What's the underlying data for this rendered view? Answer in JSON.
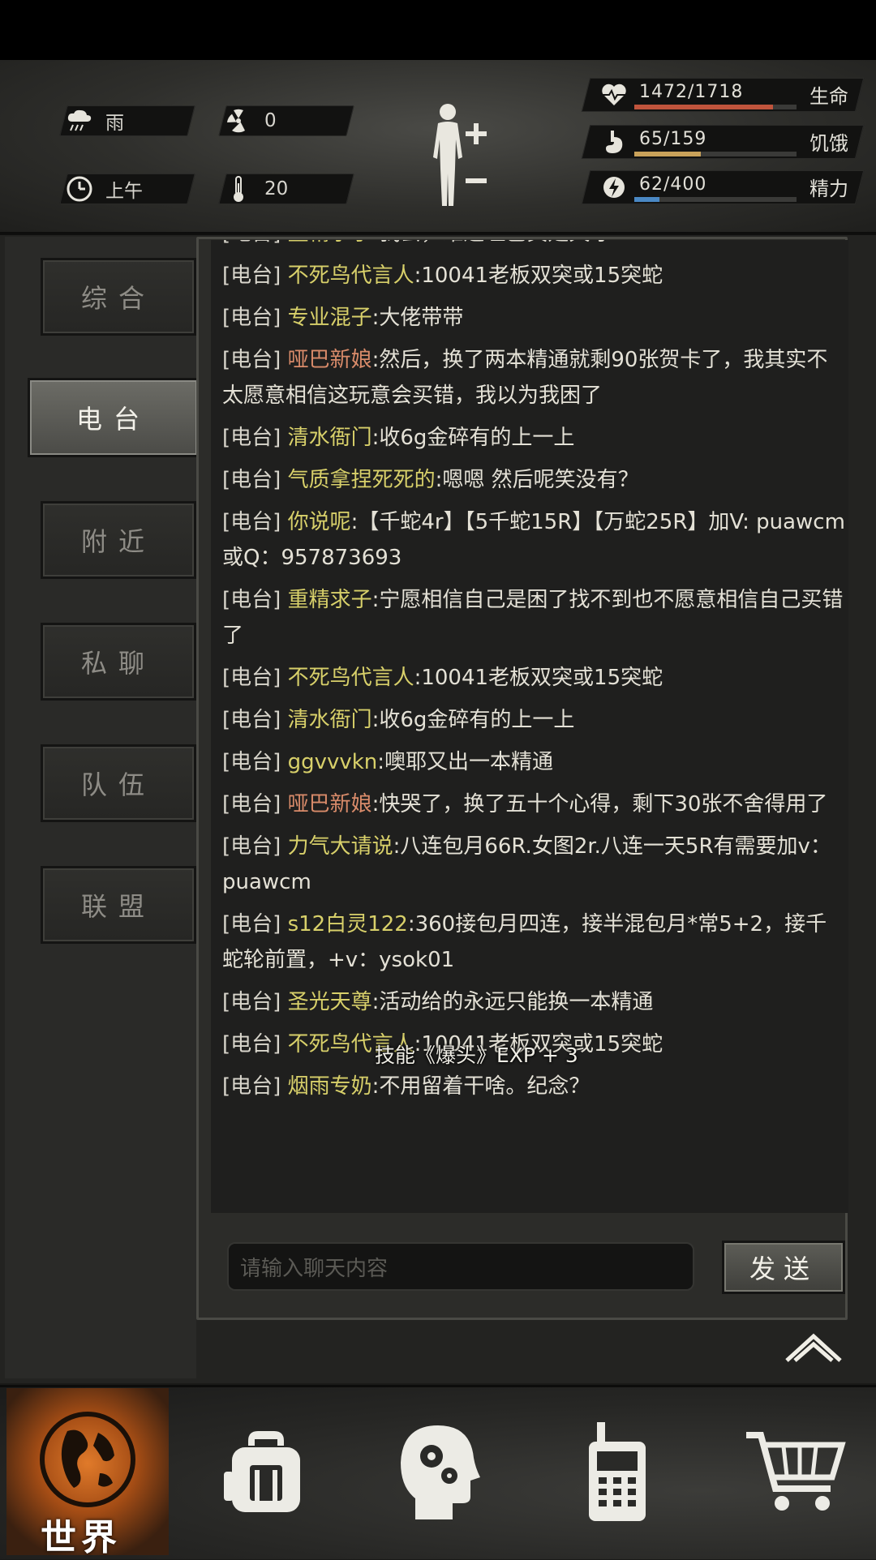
{
  "hud": {
    "weather": "雨",
    "radiation": "0",
    "time_of_day": "上午",
    "temperature": "20",
    "stats": [
      {
        "label": "生命",
        "value": "1472/1718",
        "fraction": 0.857,
        "color": "#c0543c",
        "icon": "heart-pulse-icon"
      },
      {
        "label": "饥饿",
        "value": "65/159",
        "fraction": 0.409,
        "color": "#c9a25a",
        "icon": "stomach-icon"
      },
      {
        "label": "精力",
        "value": "62/400",
        "fraction": 0.155,
        "color": "#4a88c4",
        "icon": "energy-icon"
      }
    ]
  },
  "tabs": [
    {
      "label": "综合",
      "active": false
    },
    {
      "label": "电台",
      "active": true
    },
    {
      "label": "附近",
      "active": false
    },
    {
      "label": "私聊",
      "active": false
    },
    {
      "label": "队伍",
      "active": false
    },
    {
      "label": "联盟",
      "active": false
    }
  ],
  "chat": {
    "channel_tag": "[电台]",
    "messages": [
      {
        "name": "重精求子",
        "name_color": "yellow",
        "text": ":我去，难道哑巴真是天才？"
      },
      {
        "name": "不死鸟代言人",
        "name_color": "yellow",
        "text": ":10041老板双突或15突蛇"
      },
      {
        "name": "专业混子",
        "name_color": "yellow",
        "text": ":大佬带带"
      },
      {
        "name": "哑巴新娘",
        "name_color": "red",
        "text": ":然后，换了两本精通就剩90张贺卡了，我其实不太愿意相信这玩意会买错，我以为我困了"
      },
      {
        "name": "清水衙门",
        "name_color": "yellow",
        "text": ":收6g金碎有的上一上"
      },
      {
        "name": "气质拿捏死死的",
        "name_color": "yellow",
        "text": ":嗯嗯 然后呢笑没有？"
      },
      {
        "name": "你说呢",
        "name_color": "yellow",
        "text": ":【千蛇4r】【5千蛇15R】【万蛇25R】加V: puawcm 或Q：957873693"
      },
      {
        "name": "重精求子",
        "name_color": "yellow",
        "text": ":宁愿相信自己是困了找不到也不愿意相信自己买错了"
      },
      {
        "name": "不死鸟代言人",
        "name_color": "yellow",
        "text": ":10041老板双突或15突蛇"
      },
      {
        "name": "清水衙门",
        "name_color": "yellow",
        "text": ":收6g金碎有的上一上"
      },
      {
        "name": "ggvvvkn",
        "name_color": "yellow",
        "text": ":噢耶又出一本精通"
      },
      {
        "name": "哑巴新娘",
        "name_color": "red",
        "text": ":快哭了，换了五十个心得，剩下30张不舍得用了"
      },
      {
        "name": "力气大请说",
        "name_color": "yellow",
        "text": ":八连包月66R.女图2r.八连一天5R有需要加v：puawcm"
      },
      {
        "name": "s12白灵122",
        "name_color": "yellow",
        "text": ":360接包月四连，接半混包月*常5+2，接千蛇轮前置，+v：ysok01"
      },
      {
        "name": "圣光天尊",
        "name_color": "yellow",
        "text": ":活动给的永远只能换一本精通"
      },
      {
        "name": "不死鸟代言人",
        "name_color": "yellow",
        "text": ":10041老板双突或15突蛇"
      },
      {
        "name": "烟雨专奶",
        "name_color": "yellow",
        "text": ":不用留着干啥。纪念？"
      }
    ],
    "floating_notice": "技能《爆头》EXP + 3",
    "input_placeholder": "请输入聊天内容",
    "send_label": "发送"
  },
  "bottom_nav": {
    "world_label": "世界",
    "items": [
      "world-globe-icon",
      "backpack-icon",
      "skills-head-icon",
      "radio-phone-icon",
      "cart-icon"
    ]
  }
}
